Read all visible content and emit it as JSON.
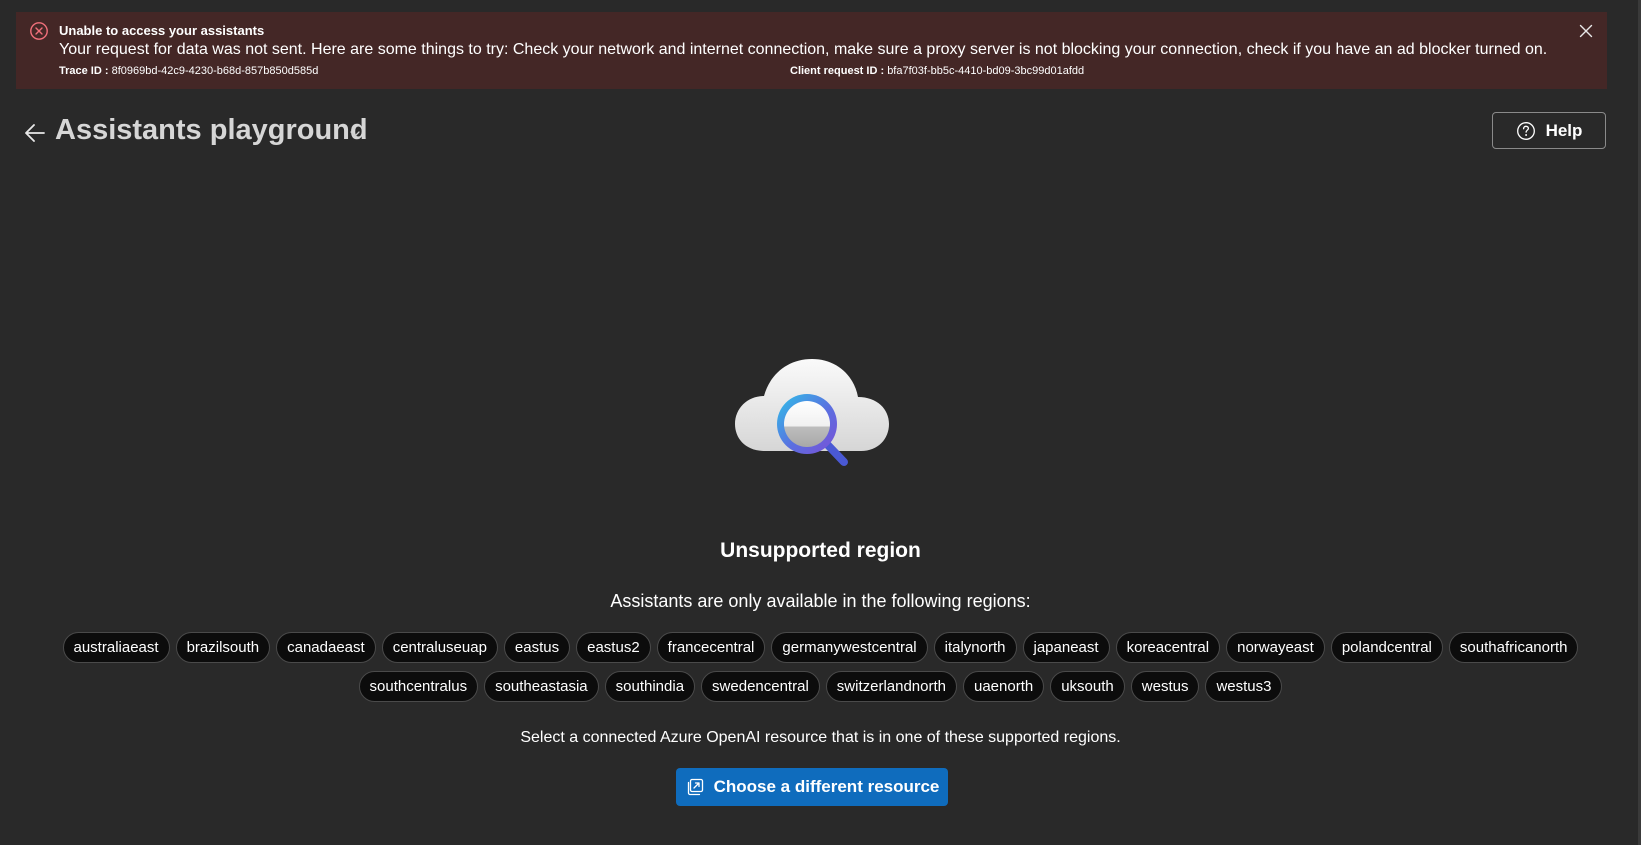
{
  "banner": {
    "title": "Unable to access your assistants",
    "message": "Your request for data was not sent. Here are some things to try: Check your network and internet connection, make sure a proxy server is not blocking your connection, check if you have an ad blocker turned on.",
    "trace_label": "Trace ID :",
    "trace_value": "8f0969bd-42c9-4230-b68d-857b850d585d",
    "client_label": "Client request ID :",
    "client_value": "bfa7f03f-bb5c-4410-bd09-3bc99d01afdd",
    "error_color": "#f1707b",
    "background_color": "#442726"
  },
  "header": {
    "title": "Assistants playground",
    "help_label": "Help"
  },
  "main": {
    "heading": "Unsupported region",
    "regions_intro": "Assistants are only available in the following regions:",
    "regions_row1": [
      "australiaeast",
      "brazilsouth",
      "canadaeast",
      "centraluseuap",
      "eastus",
      "eastus2",
      "francecentral",
      "germanywestcentral",
      "italynorth",
      "japaneast",
      "koreacentral",
      "norwayeast",
      "polandcentral",
      "southafricanorth"
    ],
    "regions_row2": [
      "southcentralus",
      "southeastasia",
      "southindia",
      "swedencentral",
      "switzerlandnorth",
      "uaenorth",
      "uksouth",
      "westus",
      "westus3"
    ],
    "select_text": "Select a connected Azure OpenAI resource that is in one of these supported regions.",
    "choose_button_label": "Choose a different resource",
    "accent_color": "#0f6cbd"
  },
  "icons": {
    "banner_status": "error-circle-icon",
    "banner_dismiss": "close-icon",
    "back": "arrow-left-icon",
    "title_menu": "chevron-down-icon",
    "help": "question-circle-icon",
    "illustration": "cloud-search-icon",
    "choose_resource": "open-window-icon"
  }
}
